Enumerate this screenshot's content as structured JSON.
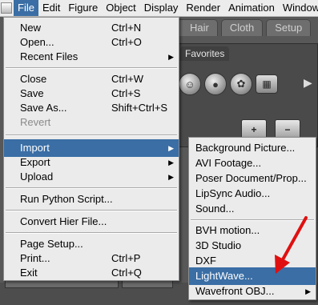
{
  "menubar": {
    "items": [
      {
        "label": "File"
      },
      {
        "label": "Edit"
      },
      {
        "label": "Figure"
      },
      {
        "label": "Object"
      },
      {
        "label": "Display"
      },
      {
        "label": "Render"
      },
      {
        "label": "Animation"
      },
      {
        "label": "Window"
      }
    ]
  },
  "tabs": [
    {
      "label": "Hair"
    },
    {
      "label": "Cloth"
    },
    {
      "label": "Setup"
    }
  ],
  "library_panel": {
    "title": "Favorites",
    "add_label": "+",
    "remove_label": "−"
  },
  "file_menu": {
    "items": [
      {
        "label": "New",
        "shortcut": "Ctrl+N"
      },
      {
        "label": "Open...",
        "shortcut": "Ctrl+O"
      },
      {
        "label": "Recent Files",
        "submenu": "▶"
      },
      {
        "label": "Close",
        "shortcut": "Ctrl+W"
      },
      {
        "label": "Save",
        "shortcut": "Ctrl+S"
      },
      {
        "label": "Save As...",
        "shortcut": "Shift+Ctrl+S"
      },
      {
        "label": "Revert",
        "disabled": true
      },
      {
        "label": "Import",
        "submenu": "▶",
        "highlighted": true
      },
      {
        "label": "Export",
        "submenu": "▶"
      },
      {
        "label": "Upload",
        "submenu": "▶"
      },
      {
        "label": "Run Python Script..."
      },
      {
        "label": "Convert Hier File..."
      },
      {
        "label": "Page Setup..."
      },
      {
        "label": "Print...",
        "shortcut": "Ctrl+P"
      },
      {
        "label": "Exit",
        "shortcut": "Ctrl+Q"
      }
    ]
  },
  "import_submenu": {
    "items": [
      {
        "label": "Background Picture..."
      },
      {
        "label": "AVI Footage..."
      },
      {
        "label": "Poser Document/Prop..."
      },
      {
        "label": "LipSync Audio..."
      },
      {
        "label": "Sound..."
      },
      {
        "label": "BVH motion..."
      },
      {
        "label": "3D Studio"
      },
      {
        "label": "DXF"
      },
      {
        "label": "LightWave...",
        "highlighted": true
      },
      {
        "label": "Wavefront OBJ...",
        "submenu": "▶"
      }
    ]
  },
  "colors": {
    "highlight": "#3a6ea5",
    "annotation_arrow": "#e01010"
  }
}
